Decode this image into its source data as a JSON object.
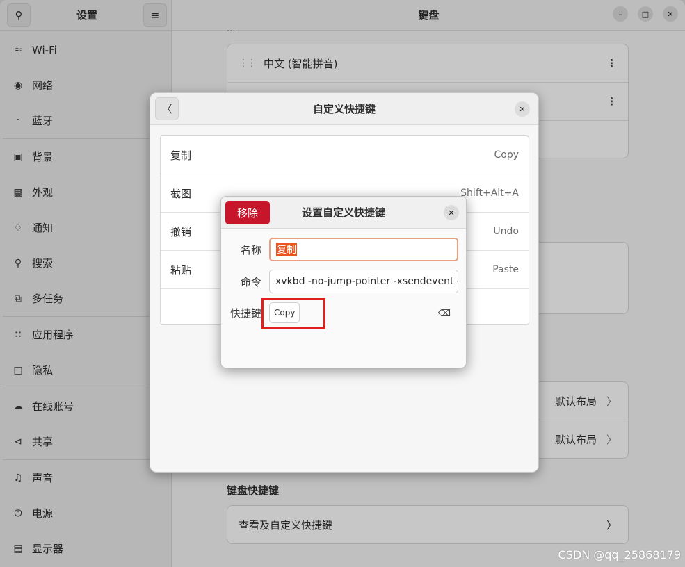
{
  "sidebar": {
    "title": "设置",
    "items": [
      {
        "label": "Wi-Fi",
        "icon": "wifi-icon"
      },
      {
        "label": "网络",
        "icon": "network-icon"
      },
      {
        "label": "蓝牙",
        "icon": "bluetooth-icon"
      },
      {
        "label": "背景",
        "icon": "background-icon"
      },
      {
        "label": "外观",
        "icon": "appearance-icon"
      },
      {
        "label": "通知",
        "icon": "bell-icon"
      },
      {
        "label": "搜索",
        "icon": "search-icon"
      },
      {
        "label": "多任务",
        "icon": "multitask-icon"
      },
      {
        "label": "应用程序",
        "icon": "apps-grid-icon"
      },
      {
        "label": "隐私",
        "icon": "lock-icon"
      },
      {
        "label": "在线账号",
        "icon": "cloud-icon"
      },
      {
        "label": "共享",
        "icon": "share-icon"
      },
      {
        "label": "声音",
        "icon": "music-note-icon"
      },
      {
        "label": "电源",
        "icon": "power-icon"
      },
      {
        "label": "显示器",
        "icon": "display-icon"
      }
    ]
  },
  "main": {
    "title": "键盘",
    "faded_text": "...",
    "input_sources": [
      "中文 (智能拼音)"
    ],
    "layout_rows": [
      {
        "value": "默认布局"
      },
      {
        "value": "默认布局"
      }
    ],
    "shortcuts_section_title": "键盘快捷键",
    "shortcuts_row_label": "查看及自定义快捷键"
  },
  "custom_shortcuts_dialog": {
    "title": "自定义快捷键",
    "rows": [
      {
        "name": "复制",
        "accel": "Copy"
      },
      {
        "name": "截图",
        "accel": "Shift+Alt+A"
      },
      {
        "name": "撤销",
        "accel": "Undo"
      },
      {
        "name": "粘贴",
        "accel": "Paste"
      }
    ]
  },
  "edit_dialog": {
    "title": "设置自定义快捷键",
    "remove_label": "移除",
    "name_label": "名称",
    "name_value": "复制",
    "command_label": "命令",
    "command_value": "xvkbd -no-jump-pointer -xsendevent -te",
    "shortcut_label": "快捷键",
    "shortcut_value": "Copy"
  },
  "watermark": "CSDN @qq_25868179",
  "colors": {
    "accent": "#e95420",
    "destructive": "#c7162b",
    "highlight_box": "#e0201d"
  }
}
